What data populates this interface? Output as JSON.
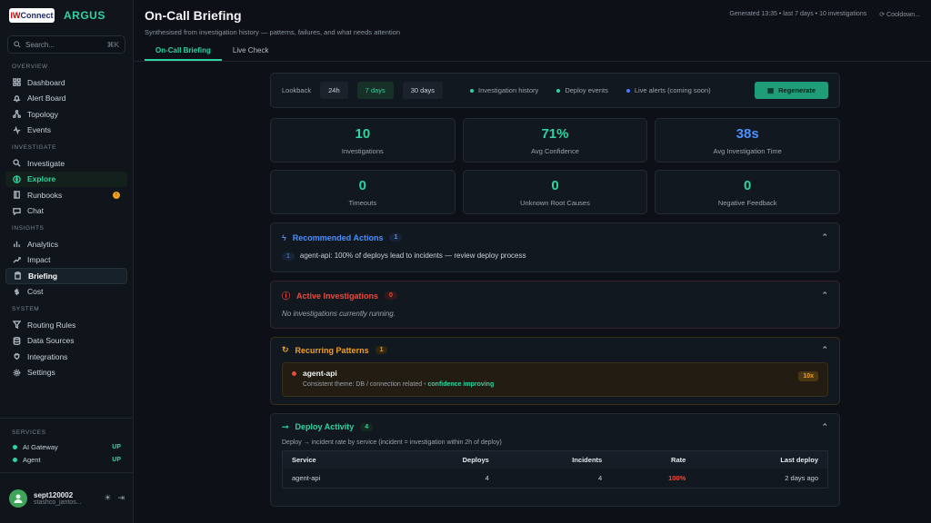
{
  "brand": {
    "logo_main": "IW",
    "logo_sub": "Connect",
    "app_name": "ARGUS"
  },
  "search": {
    "placeholder": "Search...",
    "shortcut": "⌘K"
  },
  "sidebar": {
    "sections": [
      {
        "title": "OVERVIEW",
        "items": [
          {
            "label": "Dashboard",
            "icon": "grid-icon"
          },
          {
            "label": "Alert Board",
            "icon": "bell-icon"
          },
          {
            "label": "Topology",
            "icon": "network-icon"
          },
          {
            "label": "Events",
            "icon": "activity-icon"
          }
        ]
      },
      {
        "title": "INVESTIGATE",
        "items": [
          {
            "label": "Investigate",
            "icon": "search-icon"
          },
          {
            "label": "Explore",
            "icon": "compass-icon",
            "state": "active-green"
          },
          {
            "label": "Runbooks",
            "icon": "book-icon",
            "badge": "!"
          },
          {
            "label": "Chat",
            "icon": "chat-icon"
          }
        ]
      },
      {
        "title": "INSIGHTS",
        "items": [
          {
            "label": "Analytics",
            "icon": "bar-chart-icon"
          },
          {
            "label": "Impact",
            "icon": "trending-icon"
          },
          {
            "label": "Briefing",
            "icon": "clipboard-icon",
            "state": "active"
          },
          {
            "label": "Cost",
            "icon": "dollar-icon"
          }
        ]
      },
      {
        "title": "SYSTEM",
        "items": [
          {
            "label": "Routing Rules",
            "icon": "filter-icon"
          },
          {
            "label": "Data Sources",
            "icon": "database-icon"
          },
          {
            "label": "Integrations",
            "icon": "plug-icon"
          },
          {
            "label": "Settings",
            "icon": "gear-icon"
          }
        ]
      }
    ],
    "services_title": "SERVICES",
    "services": [
      {
        "name": "AI Gateway",
        "status": "UP"
      },
      {
        "name": "Agent",
        "status": "UP"
      }
    ],
    "user": {
      "name": "sept120002",
      "email": "stashco_jantos..."
    }
  },
  "header": {
    "title": "On-Call Briefing",
    "subtitle": "Synthesised from investigation history — patterns, failures, and what needs attention",
    "generated": "Generated 13:35 • last 7 days • 10 investigations",
    "cooldown": "Cooldown..."
  },
  "tabs": [
    "On-Call Briefing",
    "Live Check"
  ],
  "lookback": {
    "label": "Lookback",
    "options": [
      "24h",
      "7 days",
      "30 days"
    ],
    "selected": "7 days",
    "legend": [
      {
        "label": "Investigation history",
        "color": "#2dd4a0"
      },
      {
        "label": "Deploy events",
        "color": "#2dd4a0"
      },
      {
        "label": "Live alerts (coming soon)",
        "color": "#4a7cff"
      }
    ],
    "regenerate": "Regenerate"
  },
  "stats": [
    {
      "value": "10",
      "label": "Investigations",
      "color": "#2dd4a0"
    },
    {
      "value": "71%",
      "label": "Avg Confidence",
      "color": "#2dd4a0"
    },
    {
      "value": "38s",
      "label": "Avg Investigation Time",
      "color": "#4a90ff"
    },
    {
      "value": "0",
      "label": "Timeouts",
      "color": "#2dd4a0"
    },
    {
      "value": "0",
      "label": "Unknown Root Causes",
      "color": "#2dd4a0"
    },
    {
      "value": "0",
      "label": "Negative Feedback",
      "color": "#2dd4a0"
    }
  ],
  "recommended": {
    "title": "Recommended Actions",
    "count": "1",
    "items": [
      {
        "n": "1",
        "text": "agent-api: 100% of deploys lead to incidents — review deploy process"
      }
    ]
  },
  "active": {
    "title": "Active Investigations",
    "count": "0",
    "empty": "No investigations currently running."
  },
  "recurring": {
    "title": "Recurring Patterns",
    "count": "1",
    "pattern": {
      "name": "agent-api",
      "desc": "Consistent theme: DB / connection related",
      "trend": "confidence improving",
      "times": "10x"
    }
  },
  "deploy": {
    "title": "Deploy Activity",
    "count": "4",
    "desc": "Deploy → incident rate by service (incident = investigation within 2h of deploy)",
    "columns": [
      "Service",
      "Deploys",
      "Incidents",
      "Rate",
      "Last deploy"
    ],
    "rows": [
      [
        "agent-api",
        "4",
        "4",
        "100%",
        "2 days ago"
      ]
    ]
  }
}
